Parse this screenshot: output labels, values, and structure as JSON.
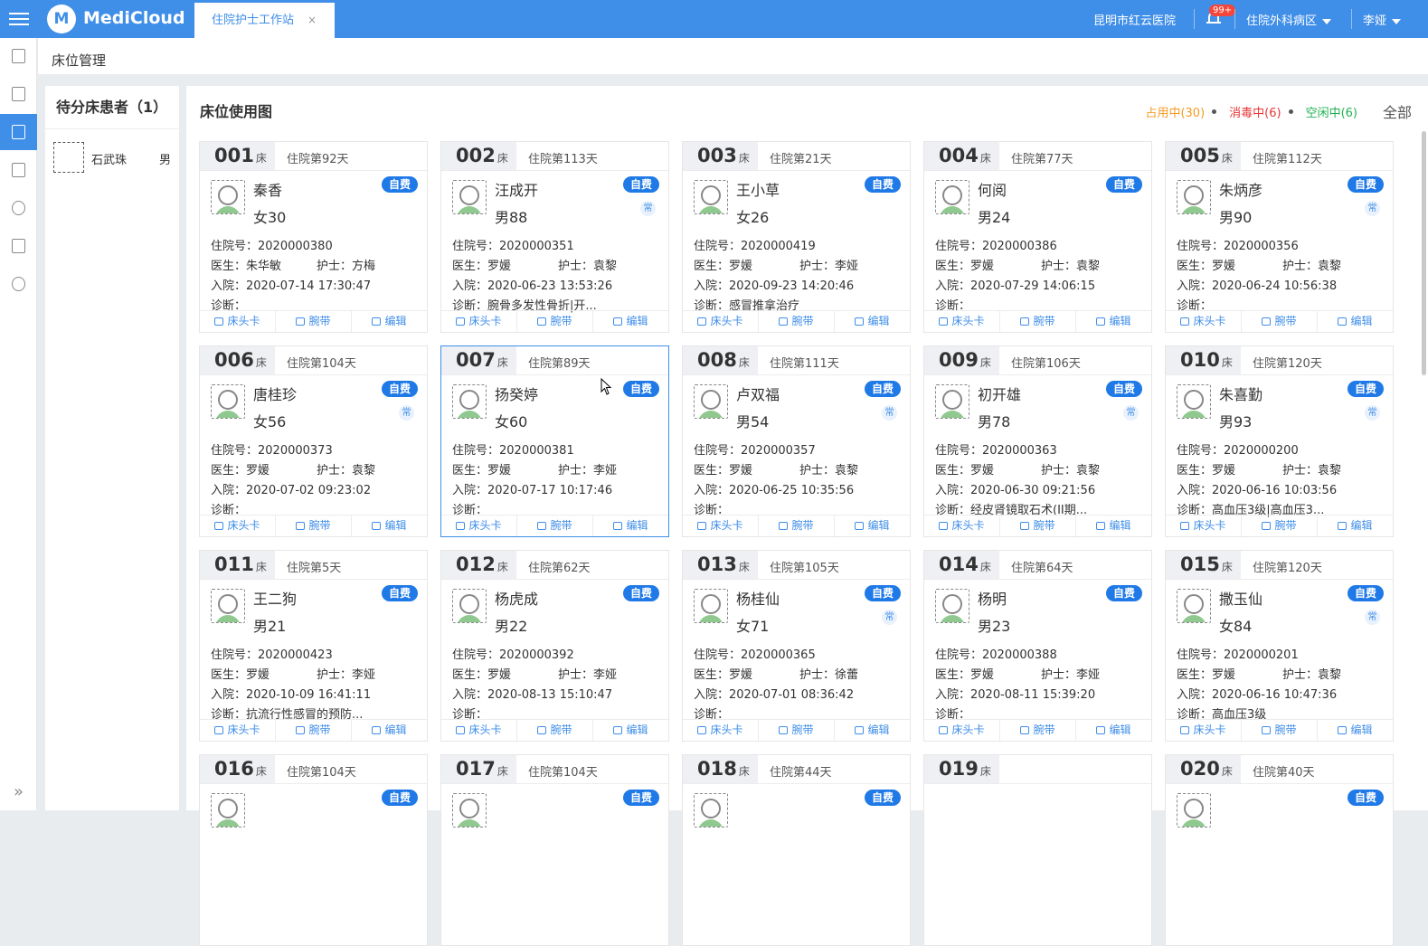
{
  "app": {
    "name": "MediCloud",
    "logo_letter": "M",
    "tab": "住院护士工作站",
    "tab_close": "×",
    "hospital": "昆明市红云医院",
    "notif_badge": "99+",
    "ward": "住院外科病区",
    "user": "李娅"
  },
  "breadcrumb": "床位管理",
  "pending": {
    "title": "待分床患者（1）",
    "patients": [
      {
        "name": "石武珠",
        "sex": "男"
      }
    ]
  },
  "main": {
    "title": "床位使用图",
    "legend": {
      "occupied": "占用中(30)",
      "disinfect": "消毒中(6)",
      "free": "空闲中(6)",
      "all": "全部"
    }
  },
  "labels": {
    "bed_suffix": "床",
    "adm_no": "住院号：",
    "doctor": "医生：",
    "nurse": "护士：",
    "admit": "入院：",
    "diag": "诊断：",
    "self_pay": "自费",
    "chang": "常",
    "btn_card": "床头卡",
    "btn_wrist": "腕带",
    "btn_edit": "编辑"
  },
  "beds": [
    {
      "no": "001",
      "days": "住院第92天",
      "name": "秦香",
      "age": "女30",
      "chang": false,
      "adm": "2020000380",
      "doctor": "朱华敏",
      "nurse": "方梅",
      "admit": "2020-07-14 17:30:47",
      "diag": ""
    },
    {
      "no": "002",
      "days": "住院第113天",
      "name": "汪成开",
      "age": "男88",
      "chang": true,
      "adm": "2020000351",
      "doctor": "罗媛",
      "nurse": "袁黎",
      "admit": "2020-06-23 13:53:26",
      "diag": "腕骨多发性骨折|开..."
    },
    {
      "no": "003",
      "days": "住院第21天",
      "name": "王小草",
      "age": "女26",
      "chang": false,
      "adm": "2020000419",
      "doctor": "罗媛",
      "nurse": "李娅",
      "admit": "2020-09-23 14:20:46",
      "diag": "感冒推拿治疗"
    },
    {
      "no": "004",
      "days": "住院第77天",
      "name": "何阅",
      "age": "男24",
      "chang": false,
      "adm": "2020000386",
      "doctor": "罗媛",
      "nurse": "袁黎",
      "admit": "2020-07-29 14:06:15",
      "diag": ""
    },
    {
      "no": "005",
      "days": "住院第112天",
      "name": "朱炳彦",
      "age": "男90",
      "chang": true,
      "adm": "2020000356",
      "doctor": "罗媛",
      "nurse": "袁黎",
      "admit": "2020-06-24 10:56:38",
      "diag": ""
    },
    {
      "no": "006",
      "days": "住院第104天",
      "name": "唐桂珍",
      "age": "女56",
      "chang": true,
      "adm": "2020000373",
      "doctor": "罗媛",
      "nurse": "袁黎",
      "admit": "2020-07-02 09:23:02",
      "diag": ""
    },
    {
      "no": "007",
      "days": "住院第89天",
      "name": "扬癸婷",
      "age": "女60",
      "chang": false,
      "adm": "2020000381",
      "doctor": "罗媛",
      "nurse": "李娅",
      "admit": "2020-07-17 10:17:46",
      "diag": "",
      "selected": true
    },
    {
      "no": "008",
      "days": "住院第111天",
      "name": "卢双福",
      "age": "男54",
      "chang": true,
      "adm": "2020000357",
      "doctor": "罗媛",
      "nurse": "袁黎",
      "admit": "2020-06-25 10:35:56",
      "diag": ""
    },
    {
      "no": "009",
      "days": "住院第106天",
      "name": "初开雄",
      "age": "男78",
      "chang": true,
      "adm": "2020000363",
      "doctor": "罗媛",
      "nurse": "袁黎",
      "admit": "2020-06-30 09:21:56",
      "diag": "经皮肾镜取石术(II期..."
    },
    {
      "no": "010",
      "days": "住院第120天",
      "name": "朱喜勤",
      "age": "男93",
      "chang": true,
      "adm": "2020000200",
      "doctor": "罗媛",
      "nurse": "袁黎",
      "admit": "2020-06-16 10:03:56",
      "diag": "高血压3级|高血压3..."
    },
    {
      "no": "011",
      "days": "住院第5天",
      "name": "王二狗",
      "age": "男21",
      "chang": false,
      "adm": "2020000423",
      "doctor": "罗媛",
      "nurse": "李娅",
      "admit": "2020-10-09 16:41:11",
      "diag": "抗流行性感冒的预防..."
    },
    {
      "no": "012",
      "days": "住院第62天",
      "name": "杨虎成",
      "age": "男22",
      "chang": false,
      "adm": "2020000392",
      "doctor": "罗媛",
      "nurse": "李娅",
      "admit": "2020-08-13 15:10:47",
      "diag": ""
    },
    {
      "no": "013",
      "days": "住院第105天",
      "name": "杨桂仙",
      "age": "女71",
      "chang": true,
      "adm": "2020000365",
      "doctor": "罗媛",
      "nurse": "徐蕾",
      "admit": "2020-07-01 08:36:42",
      "diag": ""
    },
    {
      "no": "014",
      "days": "住院第64天",
      "name": "杨明",
      "age": "男23",
      "chang": false,
      "adm": "2020000388",
      "doctor": "罗媛",
      "nurse": "李娅",
      "admit": "2020-08-11 15:39:20",
      "diag": ""
    },
    {
      "no": "015",
      "days": "住院第120天",
      "name": "撒玉仙",
      "age": "女84",
      "chang": true,
      "adm": "2020000201",
      "doctor": "罗媛",
      "nurse": "袁黎",
      "admit": "2020-06-16 10:47:36",
      "diag": "高血压3级"
    },
    {
      "no": "016",
      "days": "住院第104天",
      "partial": true
    },
    {
      "no": "017",
      "days": "住院第104天",
      "partial": true
    },
    {
      "no": "018",
      "days": "住院第44天",
      "partial": true
    },
    {
      "no": "019",
      "days": "",
      "partial": true,
      "empty": true
    },
    {
      "no": "020",
      "days": "住院第40天",
      "partial": true
    }
  ]
}
